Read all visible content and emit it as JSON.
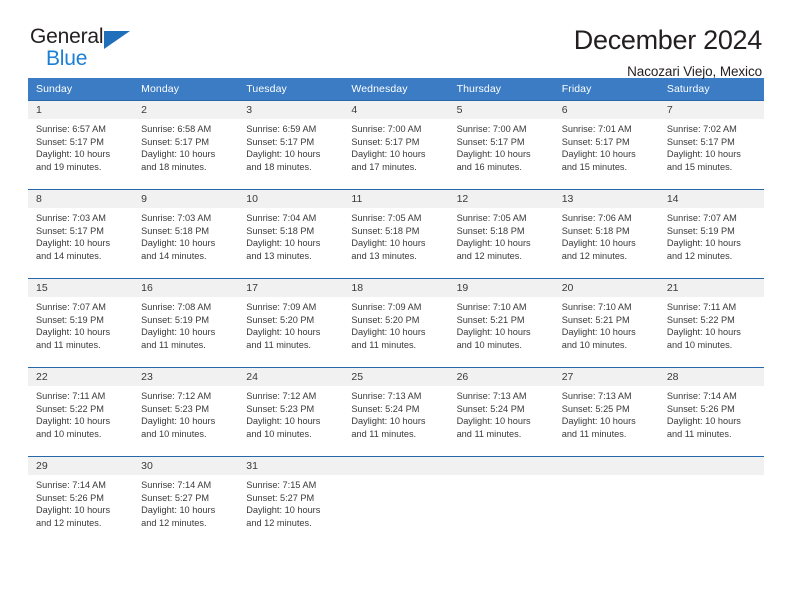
{
  "brand": {
    "name_top": "General",
    "name_bottom": "Blue",
    "triangle_color": "#1f6fba",
    "blue_text_color": "#1c7fd6"
  },
  "header": {
    "title": "December 2024",
    "subtitle": "Nacozari Viejo, Mexico"
  },
  "theme": {
    "header_bg": "#3b7cc4",
    "row_border": "#2768ad",
    "daynum_band_bg": "#f1f1f1",
    "text": "#3a3a3a"
  },
  "weekdays": [
    "Sunday",
    "Monday",
    "Tuesday",
    "Wednesday",
    "Thursday",
    "Friday",
    "Saturday"
  ],
  "labels": {
    "sunrise_prefix": "Sunrise:",
    "sunset_prefix": "Sunset:",
    "daylight_prefix": "Daylight:"
  },
  "weeks": [
    [
      {
        "day": "1",
        "sunrise": "Sunrise: 6:57 AM",
        "sunset": "Sunset: 5:17 PM",
        "daylight": "Daylight: 10 hours and 19 minutes."
      },
      {
        "day": "2",
        "sunrise": "Sunrise: 6:58 AM",
        "sunset": "Sunset: 5:17 PM",
        "daylight": "Daylight: 10 hours and 18 minutes."
      },
      {
        "day": "3",
        "sunrise": "Sunrise: 6:59 AM",
        "sunset": "Sunset: 5:17 PM",
        "daylight": "Daylight: 10 hours and 18 minutes."
      },
      {
        "day": "4",
        "sunrise": "Sunrise: 7:00 AM",
        "sunset": "Sunset: 5:17 PM",
        "daylight": "Daylight: 10 hours and 17 minutes."
      },
      {
        "day": "5",
        "sunrise": "Sunrise: 7:00 AM",
        "sunset": "Sunset: 5:17 PM",
        "daylight": "Daylight: 10 hours and 16 minutes."
      },
      {
        "day": "6",
        "sunrise": "Sunrise: 7:01 AM",
        "sunset": "Sunset: 5:17 PM",
        "daylight": "Daylight: 10 hours and 15 minutes."
      },
      {
        "day": "7",
        "sunrise": "Sunrise: 7:02 AM",
        "sunset": "Sunset: 5:17 PM",
        "daylight": "Daylight: 10 hours and 15 minutes."
      }
    ],
    [
      {
        "day": "8",
        "sunrise": "Sunrise: 7:03 AM",
        "sunset": "Sunset: 5:17 PM",
        "daylight": "Daylight: 10 hours and 14 minutes."
      },
      {
        "day": "9",
        "sunrise": "Sunrise: 7:03 AM",
        "sunset": "Sunset: 5:18 PM",
        "daylight": "Daylight: 10 hours and 14 minutes."
      },
      {
        "day": "10",
        "sunrise": "Sunrise: 7:04 AM",
        "sunset": "Sunset: 5:18 PM",
        "daylight": "Daylight: 10 hours and 13 minutes."
      },
      {
        "day": "11",
        "sunrise": "Sunrise: 7:05 AM",
        "sunset": "Sunset: 5:18 PM",
        "daylight": "Daylight: 10 hours and 13 minutes."
      },
      {
        "day": "12",
        "sunrise": "Sunrise: 7:05 AM",
        "sunset": "Sunset: 5:18 PM",
        "daylight": "Daylight: 10 hours and 12 minutes."
      },
      {
        "day": "13",
        "sunrise": "Sunrise: 7:06 AM",
        "sunset": "Sunset: 5:18 PM",
        "daylight": "Daylight: 10 hours and 12 minutes."
      },
      {
        "day": "14",
        "sunrise": "Sunrise: 7:07 AM",
        "sunset": "Sunset: 5:19 PM",
        "daylight": "Daylight: 10 hours and 12 minutes."
      }
    ],
    [
      {
        "day": "15",
        "sunrise": "Sunrise: 7:07 AM",
        "sunset": "Sunset: 5:19 PM",
        "daylight": "Daylight: 10 hours and 11 minutes."
      },
      {
        "day": "16",
        "sunrise": "Sunrise: 7:08 AM",
        "sunset": "Sunset: 5:19 PM",
        "daylight": "Daylight: 10 hours and 11 minutes."
      },
      {
        "day": "17",
        "sunrise": "Sunrise: 7:09 AM",
        "sunset": "Sunset: 5:20 PM",
        "daylight": "Daylight: 10 hours and 11 minutes."
      },
      {
        "day": "18",
        "sunrise": "Sunrise: 7:09 AM",
        "sunset": "Sunset: 5:20 PM",
        "daylight": "Daylight: 10 hours and 11 minutes."
      },
      {
        "day": "19",
        "sunrise": "Sunrise: 7:10 AM",
        "sunset": "Sunset: 5:21 PM",
        "daylight": "Daylight: 10 hours and 10 minutes."
      },
      {
        "day": "20",
        "sunrise": "Sunrise: 7:10 AM",
        "sunset": "Sunset: 5:21 PM",
        "daylight": "Daylight: 10 hours and 10 minutes."
      },
      {
        "day": "21",
        "sunrise": "Sunrise: 7:11 AM",
        "sunset": "Sunset: 5:22 PM",
        "daylight": "Daylight: 10 hours and 10 minutes."
      }
    ],
    [
      {
        "day": "22",
        "sunrise": "Sunrise: 7:11 AM",
        "sunset": "Sunset: 5:22 PM",
        "daylight": "Daylight: 10 hours and 10 minutes."
      },
      {
        "day": "23",
        "sunrise": "Sunrise: 7:12 AM",
        "sunset": "Sunset: 5:23 PM",
        "daylight": "Daylight: 10 hours and 10 minutes."
      },
      {
        "day": "24",
        "sunrise": "Sunrise: 7:12 AM",
        "sunset": "Sunset: 5:23 PM",
        "daylight": "Daylight: 10 hours and 10 minutes."
      },
      {
        "day": "25",
        "sunrise": "Sunrise: 7:13 AM",
        "sunset": "Sunset: 5:24 PM",
        "daylight": "Daylight: 10 hours and 11 minutes."
      },
      {
        "day": "26",
        "sunrise": "Sunrise: 7:13 AM",
        "sunset": "Sunset: 5:24 PM",
        "daylight": "Daylight: 10 hours and 11 minutes."
      },
      {
        "day": "27",
        "sunrise": "Sunrise: 7:13 AM",
        "sunset": "Sunset: 5:25 PM",
        "daylight": "Daylight: 10 hours and 11 minutes."
      },
      {
        "day": "28",
        "sunrise": "Sunrise: 7:14 AM",
        "sunset": "Sunset: 5:26 PM",
        "daylight": "Daylight: 10 hours and 11 minutes."
      }
    ],
    [
      {
        "day": "29",
        "sunrise": "Sunrise: 7:14 AM",
        "sunset": "Sunset: 5:26 PM",
        "daylight": "Daylight: 10 hours and 12 minutes."
      },
      {
        "day": "30",
        "sunrise": "Sunrise: 7:14 AM",
        "sunset": "Sunset: 5:27 PM",
        "daylight": "Daylight: 10 hours and 12 minutes."
      },
      {
        "day": "31",
        "sunrise": "Sunrise: 7:15 AM",
        "sunset": "Sunset: 5:27 PM",
        "daylight": "Daylight: 10 hours and 12 minutes."
      },
      {
        "day": "",
        "sunrise": "",
        "sunset": "",
        "daylight": ""
      },
      {
        "day": "",
        "sunrise": "",
        "sunset": "",
        "daylight": ""
      },
      {
        "day": "",
        "sunrise": "",
        "sunset": "",
        "daylight": ""
      },
      {
        "day": "",
        "sunrise": "",
        "sunset": "",
        "daylight": ""
      }
    ]
  ]
}
